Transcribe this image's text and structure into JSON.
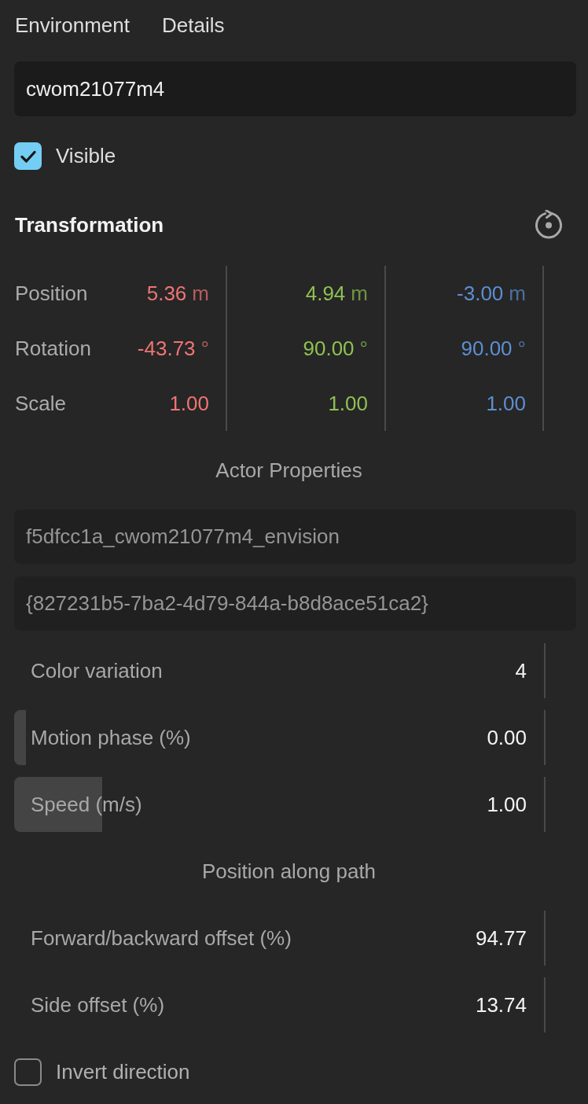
{
  "tabs": [
    {
      "label": "Environment"
    },
    {
      "label": "Details"
    }
  ],
  "name_field": {
    "value": "cwom21077m4"
  },
  "visible": {
    "label": "Visible",
    "checked": true
  },
  "transformation": {
    "title": "Transformation",
    "rows": [
      {
        "label": "Position",
        "values": [
          {
            "value": "5.36",
            "unit": "m",
            "color": "#f07474"
          },
          {
            "value": "4.94",
            "unit": "m",
            "color": "#8fc152"
          },
          {
            "value": "-3.00",
            "unit": "m",
            "color": "#5c8fd2"
          }
        ]
      },
      {
        "label": "Rotation",
        "values": [
          {
            "value": "-43.73",
            "unit": "°",
            "color": "#f07474"
          },
          {
            "value": "90.00",
            "unit": "°",
            "color": "#8fc152"
          },
          {
            "value": "90.00",
            "unit": "°",
            "color": "#5c8fd2"
          }
        ]
      },
      {
        "label": "Scale",
        "values": [
          {
            "value": "1.00",
            "color": "#f07474"
          },
          {
            "value": "1.00",
            "color": "#8fc152"
          },
          {
            "value": "1.00",
            "color": "#5c8fd2"
          }
        ]
      }
    ]
  },
  "actor_properties": {
    "title": "Actor Properties",
    "fields": [
      {
        "value": "f5dfcc1a_cwom21077m4_envision",
        "disabled": true
      },
      {
        "value": "{827231b5-7ba2-4d79-844a-b8d8ace51ca2}",
        "disabled": true
      }
    ],
    "rows": [
      {
        "kind": "number",
        "label": "Color variation",
        "value": "4"
      },
      {
        "kind": "slider",
        "label": "Motion phase (%)",
        "value": "0.00",
        "level": 0.022
      },
      {
        "kind": "slider",
        "label": "Speed (m/s)",
        "value": "1.00",
        "level": 0.166
      }
    ]
  },
  "position_along_path": {
    "title": "Position along path",
    "rows": [
      {
        "kind": "number",
        "label": "Forward/backward offset (%)",
        "value": "94.77"
      },
      {
        "kind": "number",
        "label": "Side offset (%)",
        "value": "13.74"
      }
    ]
  },
  "invert_direction": {
    "label": "Invert direction",
    "checked": false
  }
}
